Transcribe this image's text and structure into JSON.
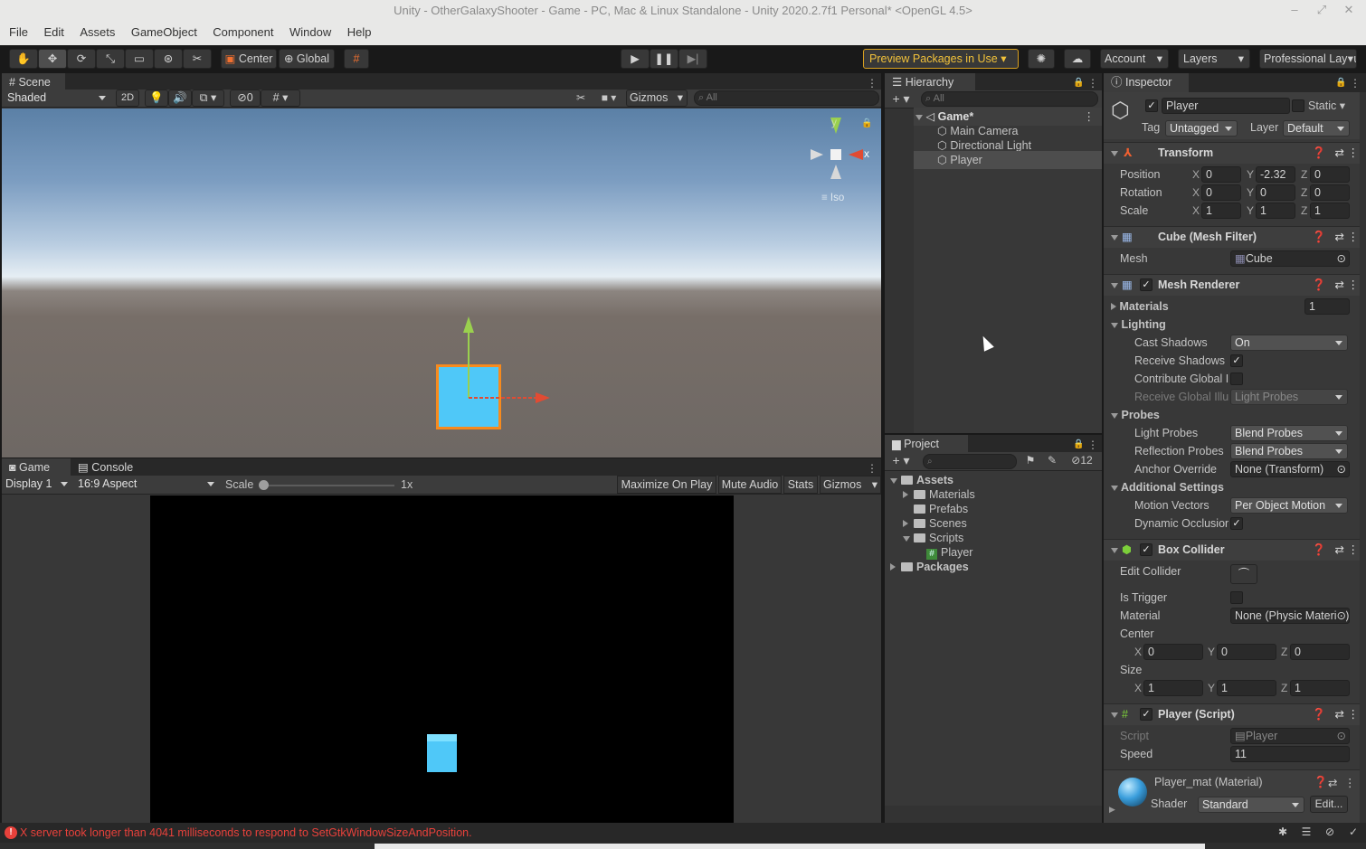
{
  "window": {
    "title": "Unity - OtherGalaxyShooter - Game - PC, Mac & Linux Standalone - Unity 2020.2.7f1 Personal* <OpenGL 4.5>"
  },
  "menu": [
    "File",
    "Edit",
    "Assets",
    "GameObject",
    "Component",
    "Window",
    "Help"
  ],
  "toolbar": {
    "pivot": "Center",
    "space": "Global",
    "preview_packages": "Preview Packages in Use",
    "account": "Account",
    "layers": "Layers",
    "layout": "Professional Layout"
  },
  "scene": {
    "tab": "Scene",
    "shading": "Shaded",
    "mode_2d": "2D",
    "hidden_count": "0",
    "gizmos": "Gizmos",
    "search_placeholder": "All",
    "axis_y": "y",
    "axis_x": "x",
    "projection": "Iso"
  },
  "game": {
    "tabs": [
      "Game",
      "Console"
    ],
    "display": "Display 1",
    "aspect": "16:9 Aspect",
    "scale_label": "Scale",
    "scale_value": "1x",
    "maximize": "Maximize On Play",
    "mute": "Mute Audio",
    "stats": "Stats",
    "gizmos": "Gizmos"
  },
  "hierarchy": {
    "tab": "Hierarchy",
    "search_placeholder": "All",
    "scene_name": "Game*",
    "items": [
      "Main Camera",
      "Directional Light",
      "Player"
    ]
  },
  "project": {
    "tab": "Project",
    "hidden_count": "12",
    "tree": [
      {
        "name": "Assets",
        "depth": 0,
        "expanded": true,
        "bold": true
      },
      {
        "name": "Materials",
        "depth": 1,
        "expanded": false
      },
      {
        "name": "Prefabs",
        "depth": 1,
        "expanded": null
      },
      {
        "name": "Scenes",
        "depth": 1,
        "expanded": false
      },
      {
        "name": "Scripts",
        "depth": 1,
        "expanded": true
      },
      {
        "name": "Player",
        "depth": 2,
        "expanded": null,
        "script": true
      },
      {
        "name": "Packages",
        "depth": 0,
        "expanded": false,
        "bold": true
      }
    ]
  },
  "inspector": {
    "tab": "Inspector",
    "object_name": "Player",
    "static_label": "Static",
    "tag_label": "Tag",
    "tag": "Untagged",
    "layer_label": "Layer",
    "layer": "Default",
    "transform": {
      "title": "Transform",
      "position_label": "Position",
      "position": {
        "x": "0",
        "y": "-2.32",
        "z": "0"
      },
      "rotation_label": "Rotation",
      "rotation": {
        "x": "0",
        "y": "0",
        "z": "0"
      },
      "scale_label": "Scale",
      "scale": {
        "x": "1",
        "y": "1",
        "z": "1"
      }
    },
    "mesh_filter": {
      "title": "Cube (Mesh Filter)",
      "mesh_label": "Mesh",
      "mesh": "Cube"
    },
    "mesh_renderer": {
      "title": "Mesh Renderer",
      "materials_label": "Materials",
      "materials_count": "1",
      "lighting_label": "Lighting",
      "cast_shadows_label": "Cast Shadows",
      "cast_shadows": "On",
      "receive_shadows_label": "Receive Shadows",
      "contribute_gi_label": "Contribute Global I",
      "receive_gi_label": "Receive Global Illu",
      "receive_gi": "Light Probes",
      "probes_label": "Probes",
      "light_probes_label": "Light Probes",
      "light_probes": "Blend Probes",
      "reflection_probes_label": "Reflection Probes",
      "reflection_probes": "Blend Probes",
      "anchor_override_label": "Anchor Override",
      "anchor_override": "None (Transform)",
      "additional_label": "Additional Settings",
      "motion_vectors_label": "Motion Vectors",
      "motion_vectors": "Per Object Motion",
      "dynamic_occlusion_label": "Dynamic Occlusion"
    },
    "box_collider": {
      "title": "Box Collider",
      "edit_collider_label": "Edit Collider",
      "is_trigger_label": "Is Trigger",
      "material_label": "Material",
      "material": "None (Physic Material)",
      "center_label": "Center",
      "center": {
        "x": "0",
        "y": "0",
        "z": "0"
      },
      "size_label": "Size",
      "size": {
        "x": "1",
        "y": "1",
        "z": "1"
      }
    },
    "player_script": {
      "title": "Player (Script)",
      "script_label": "Script",
      "script": "Player",
      "speed_label": "Speed",
      "speed": "11"
    },
    "material": {
      "title": "Player_mat (Material)",
      "shader_label": "Shader",
      "shader": "Standard",
      "edit": "Edit..."
    }
  },
  "status": {
    "message": "X server took longer than 4041 milliseconds to respond to SetGtkWindowSizeAndPosition."
  },
  "colors": {
    "accent_cube": "#4fc8f8",
    "selection_orange": "#f78a1d",
    "error_red": "#e8413b"
  }
}
